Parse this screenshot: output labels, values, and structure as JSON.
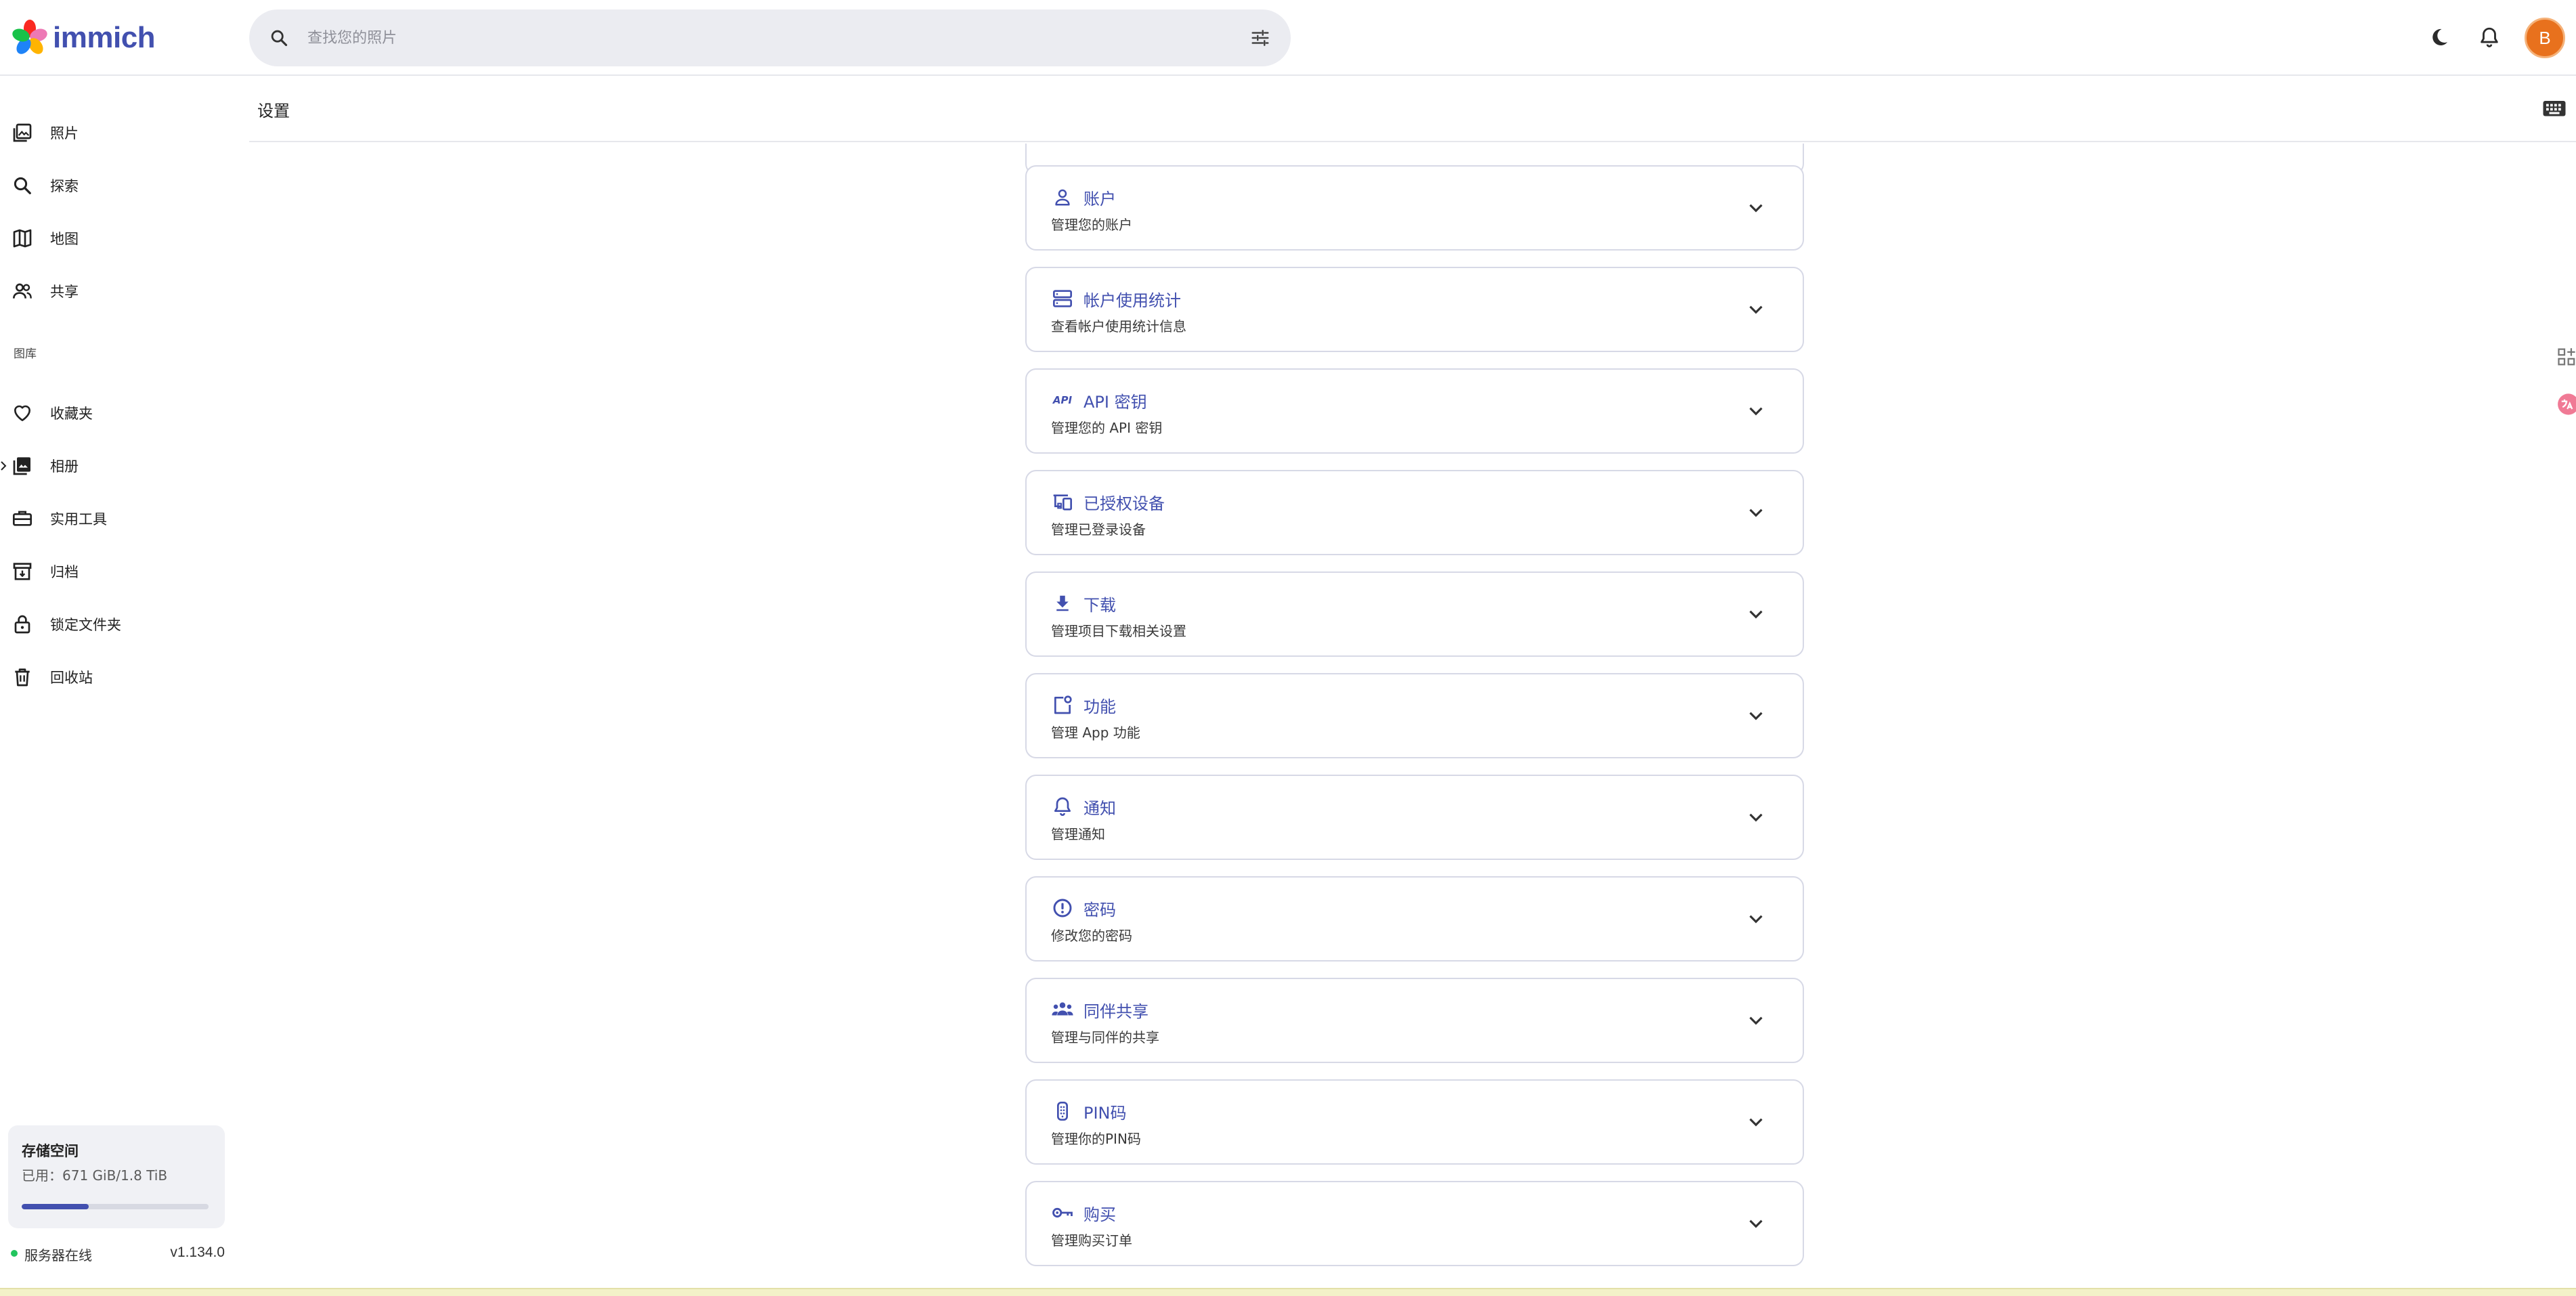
{
  "app": {
    "logo_text": "immich"
  },
  "search": {
    "placeholder": "查找您的照片"
  },
  "user": {
    "avatar_initial": "B",
    "avatar_color": "#e8711d"
  },
  "colors": {
    "accent": "#4250af",
    "online": "#22c55e"
  },
  "sidebar": {
    "items": [
      {
        "label": "照片",
        "icon": "photos-icon"
      },
      {
        "label": "探索",
        "icon": "search-icon"
      },
      {
        "label": "地图",
        "icon": "map-icon"
      },
      {
        "label": "共享",
        "icon": "sharing-icon"
      }
    ],
    "library_label": "图库",
    "library_items": [
      {
        "label": "收藏夹",
        "icon": "heart-icon"
      },
      {
        "label": "相册",
        "icon": "album-icon"
      },
      {
        "label": "实用工具",
        "icon": "toolbox-icon"
      },
      {
        "label": "归档",
        "icon": "archive-icon"
      },
      {
        "label": "锁定文件夹",
        "icon": "lock-icon"
      },
      {
        "label": "回收站",
        "icon": "trash-icon"
      }
    ]
  },
  "storage": {
    "title": "存储空间",
    "usage": "已用：671 GiB/1.8 TiB",
    "used_fraction": 0.36
  },
  "server": {
    "status": "服务器在线",
    "version": "v1.134.0"
  },
  "page": {
    "title": "设置"
  },
  "settings": [
    {
      "title": "账户",
      "description": "管理您的账户",
      "icon": "account-icon"
    },
    {
      "title": "帐户使用统计",
      "description": "查看帐户使用统计信息",
      "icon": "usage-stats-icon"
    },
    {
      "title": "API 密钥",
      "description": "管理您的 API 密钥",
      "icon": "api-icon",
      "icon_text": "API"
    },
    {
      "title": "已授权设备",
      "description": "管理已登录设备",
      "icon": "devices-icon"
    },
    {
      "title": "下载",
      "description": "管理项目下载相关设置",
      "icon": "download-icon"
    },
    {
      "title": "功能",
      "description": "管理 App 功能",
      "icon": "features-icon"
    },
    {
      "title": "通知",
      "description": "管理通知",
      "icon": "bell-icon"
    },
    {
      "title": "密码",
      "description": "修改您的密码",
      "icon": "password-icon"
    },
    {
      "title": "同伴共享",
      "description": "管理与同伴的共享",
      "icon": "partner-sharing-icon"
    },
    {
      "title": "PIN码",
      "description": "管理你的PIN码",
      "icon": "pin-icon"
    },
    {
      "title": "购买",
      "description": "管理购买订单",
      "icon": "key-icon"
    }
  ]
}
